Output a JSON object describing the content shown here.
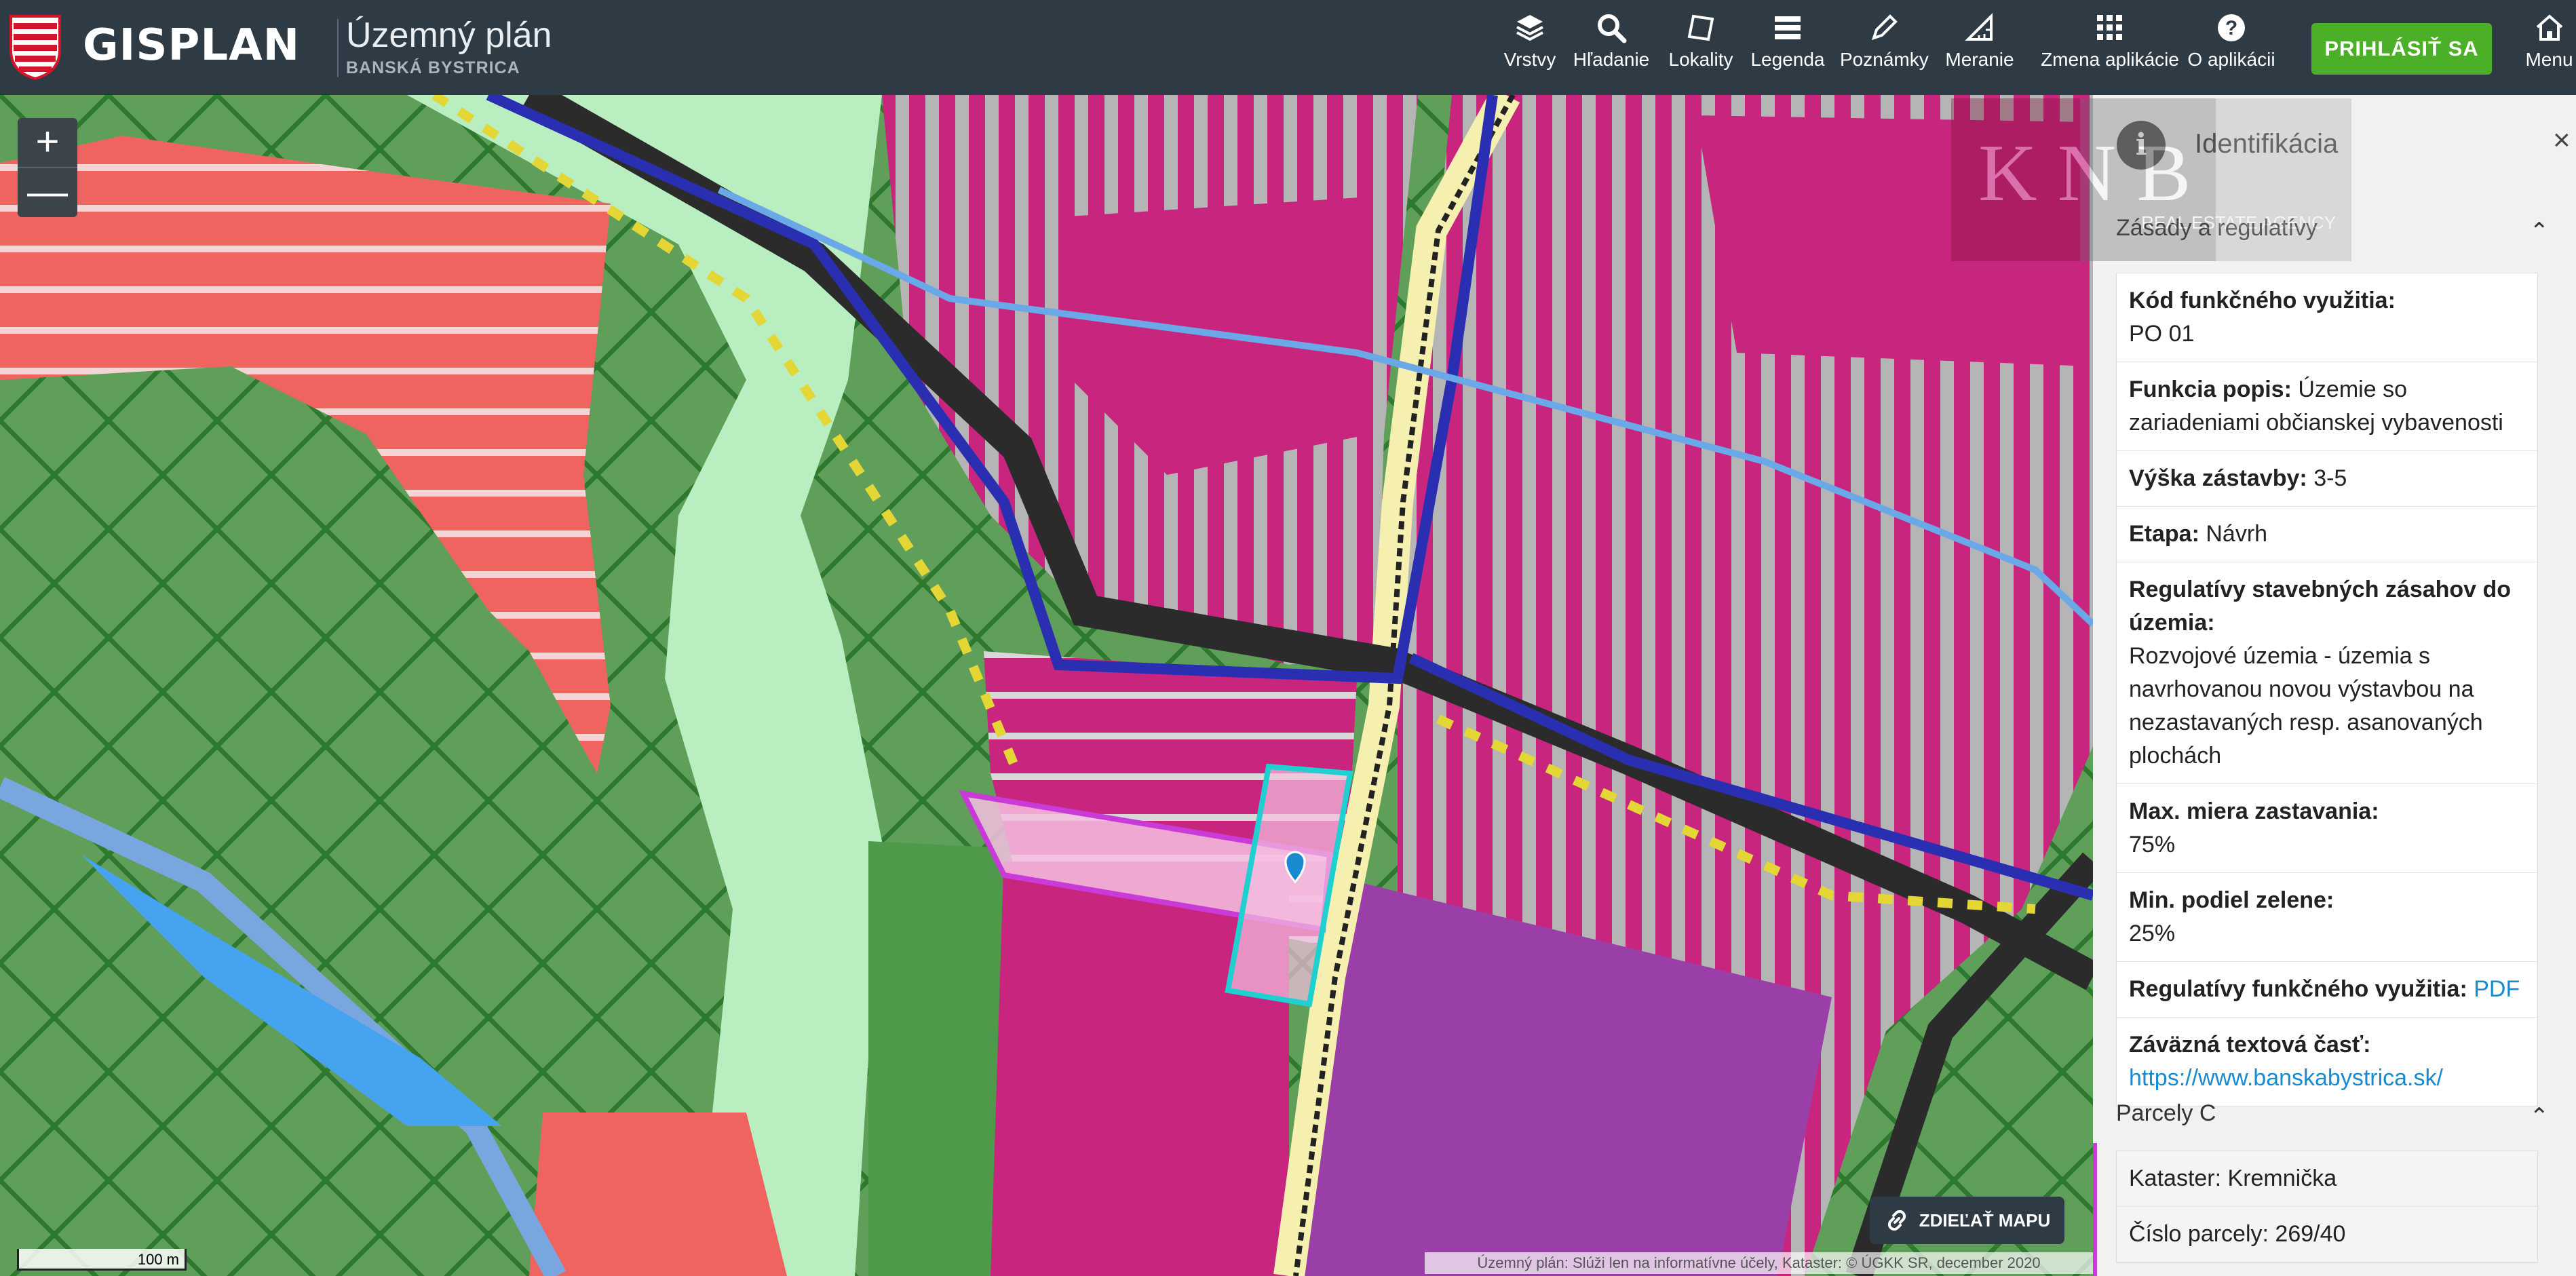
{
  "header": {
    "logo_text": "GISPLAN",
    "app_title": "Územný plán",
    "app_subtitle": "BANSKÁ BYSTRICA",
    "login_label": "PRIHLÁSIŤ SA",
    "tools": [
      {
        "label": "Vrstvy",
        "icon": "layers-icon"
      },
      {
        "label": "Hľadanie",
        "icon": "search-icon"
      },
      {
        "label": "Lokality",
        "icon": "map-shape-icon"
      },
      {
        "label": "Legenda",
        "icon": "list-icon"
      },
      {
        "label": "Poznámky",
        "icon": "pencil-icon"
      },
      {
        "label": "Meranie",
        "icon": "ruler-icon"
      },
      {
        "label": "Zmena aplikácie",
        "icon": "grid-icon"
      },
      {
        "label": "O aplikácii",
        "icon": "help-icon"
      },
      {
        "label": "Menu",
        "icon": "home-icon"
      }
    ]
  },
  "map": {
    "zoom_in": "+",
    "zoom_out": "—",
    "scale_label": "100 m",
    "share_label": "ZDIEĽAŤ MAPU",
    "attribution": "Územný plán: Slúži len na informatívne účely, Kataster: © ÚGKK SR, december 2020"
  },
  "panel": {
    "title": "Identifikácia",
    "close": "×",
    "section1": {
      "title": "Zásady a regulatívy",
      "chevron": "^"
    },
    "rows": {
      "kod_label": "Kód funkčného využitia:",
      "kod_value": "PO 01",
      "funkcia_label": "Funkcia popis:",
      "funkcia_value": "Územie so zariadeniami občianskej vybavenosti",
      "vyska_label": "Výška zástavby:",
      "vyska_value": "3-5",
      "etapa_label": "Etapa:",
      "etapa_value": "Návrh",
      "regul_label": "Regulatívy stavebných zásahov do územia:",
      "regul_value": "Rozvojové územia - územia s navrhovanou novou výstavbou na nezastavaných resp. asanovaných plochách",
      "max_label": "Max. miera zastavania:",
      "max_value": "75%",
      "min_label": "Min. podiel zelene:",
      "min_value": "25%",
      "regfun_label": "Regulatívy funkčného využitia:",
      "regfun_link": "PDF",
      "zavazna_label": "Záväzná textová časť:",
      "zavazna_link": "https://www.banskabystrica.sk/"
    },
    "section2": {
      "title": "Parcely C",
      "chevron": "^"
    },
    "parcely": {
      "kataster": "Kataster: Kremnička",
      "cislo": "Číslo parcely: 269/40"
    },
    "watermark": {
      "letters": "K N B",
      "tagline": "REAL ESTATE AGENCY"
    }
  },
  "colors": {
    "header": "#2e3a44",
    "login": "#4caf28",
    "link": "#1a8ad0",
    "magenta": "#c8257f",
    "forest": "#5f9f5a"
  }
}
